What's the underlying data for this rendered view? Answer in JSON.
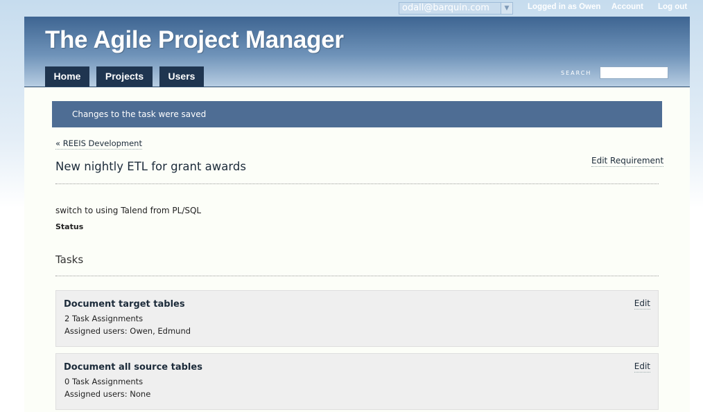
{
  "topbar": {
    "account_select": {
      "value": "odall@barquin.com"
    },
    "logged_in_text": "Logged in as Owen",
    "account_link": "Account",
    "logout_link": "Log out"
  },
  "header": {
    "site_title": "The Agile Project Manager",
    "nav": [
      "Home",
      "Projects",
      "Users"
    ],
    "search_label": "SEARCH",
    "search_value": ""
  },
  "flash": {
    "message": "Changes to the task were saved"
  },
  "requirement": {
    "breadcrumb": "« REEIS Development",
    "edit_link": "Edit Requirement",
    "title": "New nightly ETL for grant awards",
    "description": "switch to using Talend from PL/SQL",
    "status_label": "Status"
  },
  "tasks": {
    "heading": "Tasks",
    "items": [
      {
        "name": "Document target tables",
        "assignments": "2 Task Assignments",
        "assigned_users": "Assigned users: Owen, Edmund",
        "edit_label": "Edit"
      },
      {
        "name": "Document all source tables",
        "assignments": "0 Task Assignments",
        "assigned_users": "Assigned users: None",
        "edit_label": "Edit"
      }
    ]
  },
  "colors": {
    "header_dark": "#3e6592",
    "nav_tab": "#1f3550",
    "flash_bg": "#4e6d94",
    "content_bg": "#fcfef8",
    "task_card_bg": "#efefef"
  }
}
